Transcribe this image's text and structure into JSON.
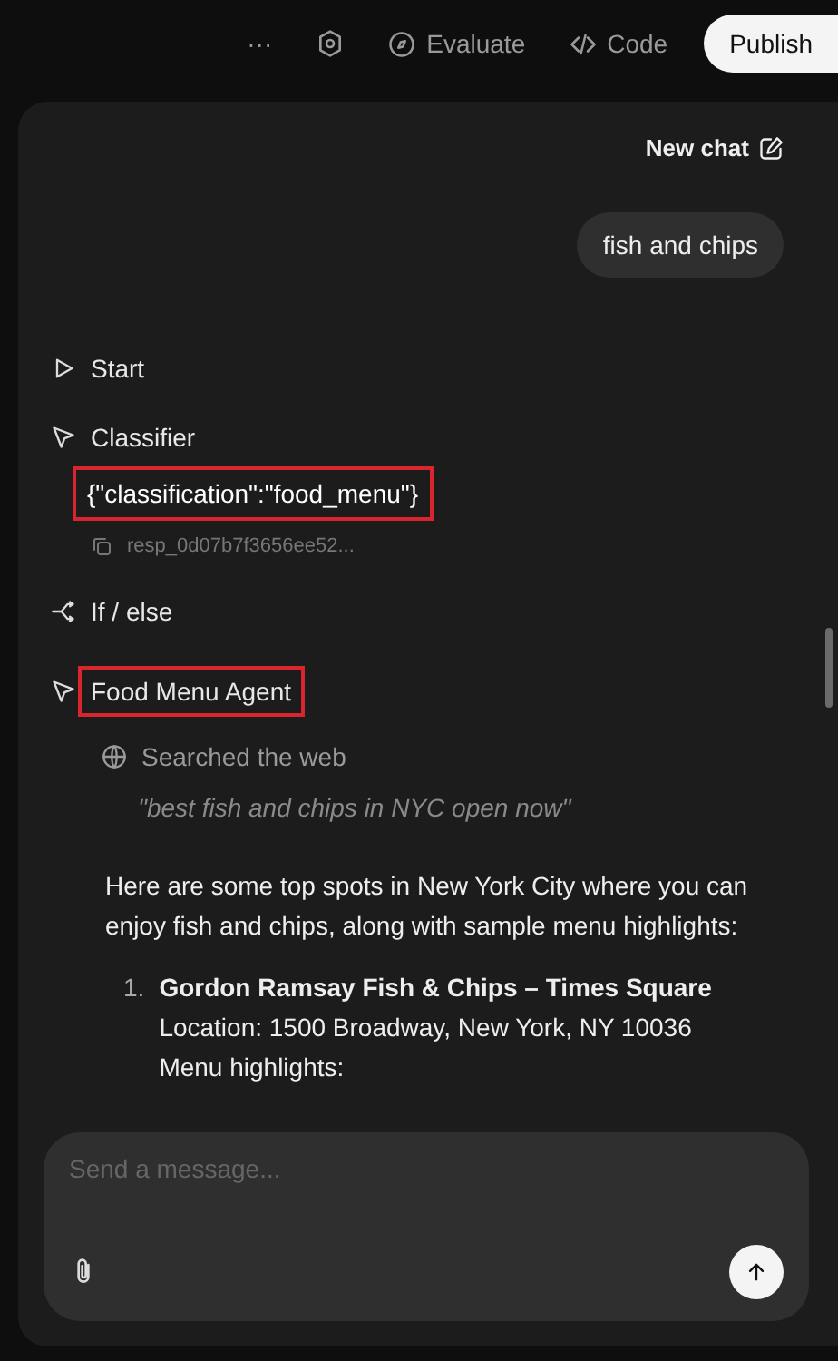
{
  "toolbar": {
    "items": [
      {
        "kind": "more",
        "label": "···"
      },
      {
        "kind": "settings"
      },
      {
        "kind": "evaluate",
        "label": "Evaluate"
      },
      {
        "kind": "code",
        "label": "Code"
      }
    ],
    "publish": "Publish"
  },
  "chat": {
    "new_chat": "New chat",
    "user_message": "fish and chips",
    "steps": [
      {
        "kind": "start",
        "title": "Start",
        "highlighted": false
      },
      {
        "kind": "classifier",
        "title": "Classifier",
        "highlighted": false,
        "output": "{\"classification\":\"food_menu\"}",
        "output_highlighted": true,
        "response_id": "resp_0d07b7f3656ee52..."
      },
      {
        "kind": "ifelse",
        "title": "If / else",
        "highlighted": false
      },
      {
        "kind": "agent",
        "title": "Food Menu Agent",
        "highlighted": true,
        "search_label": "Searched the web",
        "search_query": "\"best fish and chips in NYC open now\""
      }
    ],
    "answer": {
      "intro": "Here are some top spots in New York City where you can enjoy fish and chips, along with sample menu highlights:",
      "items": [
        {
          "number": "1.",
          "title": "Gordon Ramsay Fish & Chips – Times Square",
          "lines": [
            "Location: 1500 Broadway, New York, NY 10036",
            "Menu highlights:"
          ]
        }
      ]
    },
    "composer": {
      "placeholder": "Send a message..."
    }
  }
}
